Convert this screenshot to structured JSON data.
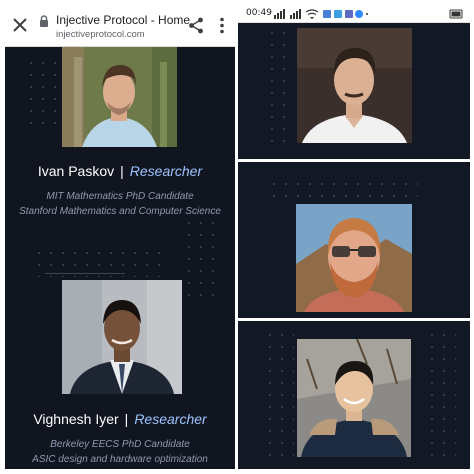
{
  "browser": {
    "page_title": "Injective Protocol - Home",
    "url": "injectiveprotocol.com"
  },
  "status_bar": {
    "time": "00:49"
  },
  "team": [
    {
      "name": "Ivan Paskov",
      "role": "Researcher",
      "separator": "|",
      "description": [
        "MIT Mathematics PhD Candidate",
        "Stanford Mathematics and Computer Science"
      ]
    },
    {
      "name": "Vighnesh Iyer",
      "role": "Researcher",
      "separator": "|",
      "description": [
        "Berkeley EECS PhD Candidate",
        "ASIC design and hardware optimization"
      ]
    }
  ],
  "icons": {
    "close": "close-icon",
    "lock": "lock-icon",
    "share": "share-icon",
    "more": "more-vert-icon"
  },
  "colors": {
    "background": "#10151f",
    "role_accent": "#9cc4ff",
    "description": "#8f9bb0"
  }
}
